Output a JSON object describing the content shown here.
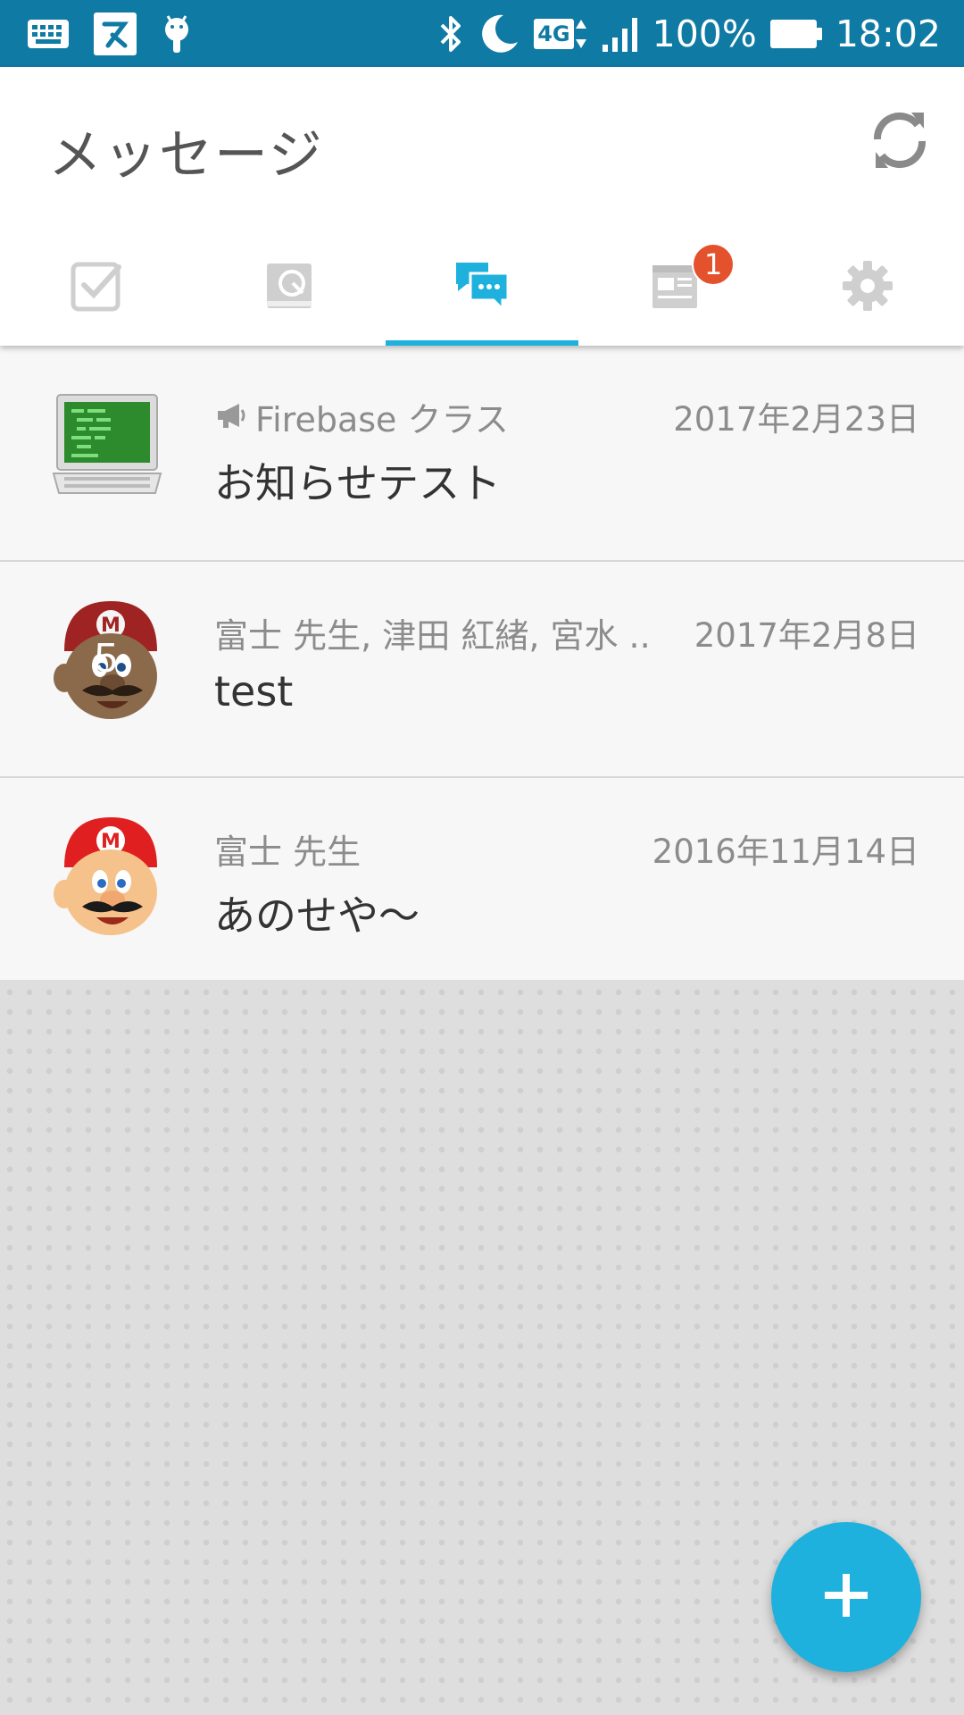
{
  "status_bar": {
    "battery": "100%",
    "time": "18:02",
    "network": "4G",
    "icons": [
      "keyboard-icon",
      "app-notification-icon",
      "android-debug-icon",
      "bluetooth-icon",
      "do-not-disturb-moon-icon",
      "network-4g-icon",
      "signal-icon",
      "battery-icon"
    ]
  },
  "header": {
    "title": "メッセージ",
    "refresh_icon": "refresh-icon"
  },
  "tabs": [
    {
      "name": "tasks",
      "icon": "checkbox-icon",
      "active": false
    },
    {
      "name": "notes",
      "icon": "notebook-icon",
      "active": false
    },
    {
      "name": "messages",
      "icon": "chat-bubbles-icon",
      "active": true
    },
    {
      "name": "news",
      "icon": "newspaper-icon",
      "active": false,
      "badge": "1"
    },
    {
      "name": "settings",
      "icon": "gear-icon",
      "active": false
    }
  ],
  "messages": [
    {
      "sender": "Firebase クラス",
      "sender_icon": "megaphone-icon",
      "date": "2017年2月23日",
      "body": "お知らせテスト",
      "avatar": "laptop-computer-avatar"
    },
    {
      "sender": "富士 先生, 津田 紅緒, 宮水 ...",
      "date": "2017年2月8日",
      "body": "test",
      "avatar": "mario-avatar-group",
      "avatar_count": "5"
    },
    {
      "sender": "富士 先生",
      "date": "2016年11月14日",
      "body": "あのせや〜",
      "avatar": "mario-avatar"
    }
  ],
  "fab": {
    "label": "+",
    "icon": "plus-icon"
  },
  "colors": {
    "status_bar": "#0f7aa3",
    "accent": "#1fb1de",
    "badge": "#e4512d",
    "inactive_icon": "#cfcfcf"
  }
}
